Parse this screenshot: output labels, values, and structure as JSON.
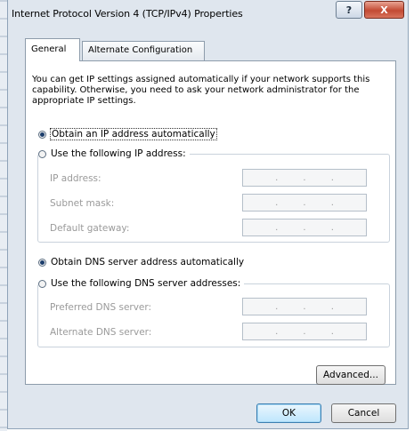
{
  "window": {
    "title": "Internet Protocol Version 4 (TCP/IPv4) Properties",
    "help_label": "?",
    "close_label": "X"
  },
  "tabs": [
    {
      "label": "General",
      "selected": true
    },
    {
      "label": "Alternate Configuration",
      "selected": false
    }
  ],
  "intro_text": "You can get IP settings assigned automatically if your network supports this capability. Otherwise, you need to ask your network administrator for the appropriate IP settings.",
  "ip_section": {
    "auto_label": "Obtain an IP address automatically",
    "auto_selected": true,
    "manual_label": "Use the following IP address:",
    "fields": [
      {
        "label": "IP address:",
        "value": ".   .   ."
      },
      {
        "label": "Subnet mask:",
        "value": ".   .   ."
      },
      {
        "label": "Default gateway:",
        "value": ".   .   ."
      }
    ]
  },
  "dns_section": {
    "auto_label": "Obtain DNS server address automatically",
    "auto_selected": true,
    "manual_label": "Use the following DNS server addresses:",
    "fields": [
      {
        "label": "Preferred DNS server:",
        "value": ".   .   ."
      },
      {
        "label": "Alternate DNS server:",
        "value": ".   .   ."
      }
    ]
  },
  "buttons": {
    "advanced": "Advanced...",
    "ok": "OK",
    "cancel": "Cancel"
  }
}
